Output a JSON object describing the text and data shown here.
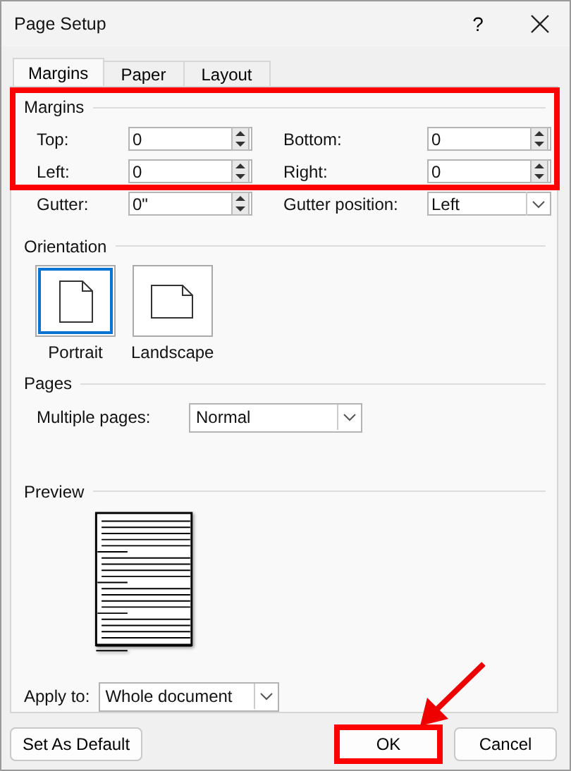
{
  "window": {
    "title": "Page Setup",
    "help": "?"
  },
  "tabs": [
    {
      "label": "Margins",
      "selected": true
    },
    {
      "label": "Paper",
      "selected": false
    },
    {
      "label": "Layout",
      "selected": false
    }
  ],
  "margins": {
    "heading": "Margins",
    "highlighted": true,
    "fields": [
      {
        "label": "Top:",
        "value": "0"
      },
      {
        "label": "Bottom:",
        "value": "0"
      },
      {
        "label": "Left:",
        "value": "0"
      },
      {
        "label": "Right:",
        "value": "0"
      }
    ]
  },
  "gutter": {
    "label": "Gutter:",
    "value": "0\""
  },
  "gutter_position": {
    "label": "Gutter position:",
    "value": "Left"
  },
  "orientation": {
    "heading": "Orientation",
    "options": [
      {
        "kind": "portrait",
        "label": "Portrait",
        "selected": true
      },
      {
        "kind": "landscape",
        "label": "Landscape",
        "selected": false
      }
    ]
  },
  "pages": {
    "heading": "Pages",
    "multiple_pages": {
      "label": "Multiple pages:",
      "value": "Normal"
    }
  },
  "preview": {
    "heading": "Preview"
  },
  "apply_to": {
    "label": "Apply to:",
    "value": "Whole document"
  },
  "buttons": [
    {
      "label": "Set As Default",
      "highlighted": false
    },
    {
      "label": "OK",
      "highlighted": true
    },
    {
      "label": "Cancel",
      "highlighted": false
    }
  ]
}
